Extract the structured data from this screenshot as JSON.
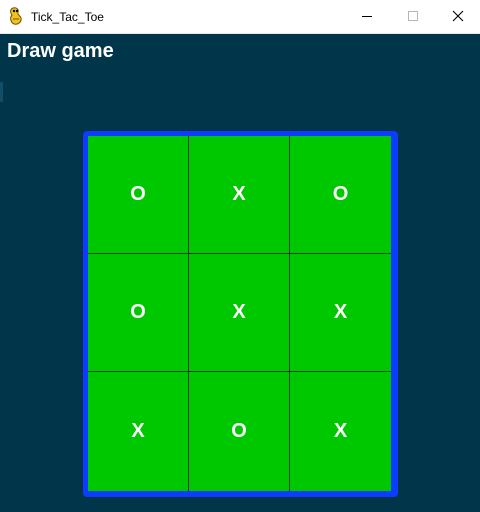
{
  "window": {
    "title": "Tick_Tac_Toe",
    "icon": "pygame-snake-icon",
    "controls": [
      "minimize-icon",
      "maximize-icon",
      "close-icon"
    ]
  },
  "game": {
    "status": "Draw game",
    "board": [
      [
        "O",
        "X",
        "O"
      ],
      [
        "O",
        "X",
        "X"
      ],
      [
        "X",
        "O",
        "X"
      ]
    ]
  },
  "colors": {
    "background": "#00354a",
    "board_fill": "#00c800",
    "board_border": "#0b3cff",
    "grid_lines": "#1e3b1e",
    "marks": "#ffffff"
  }
}
